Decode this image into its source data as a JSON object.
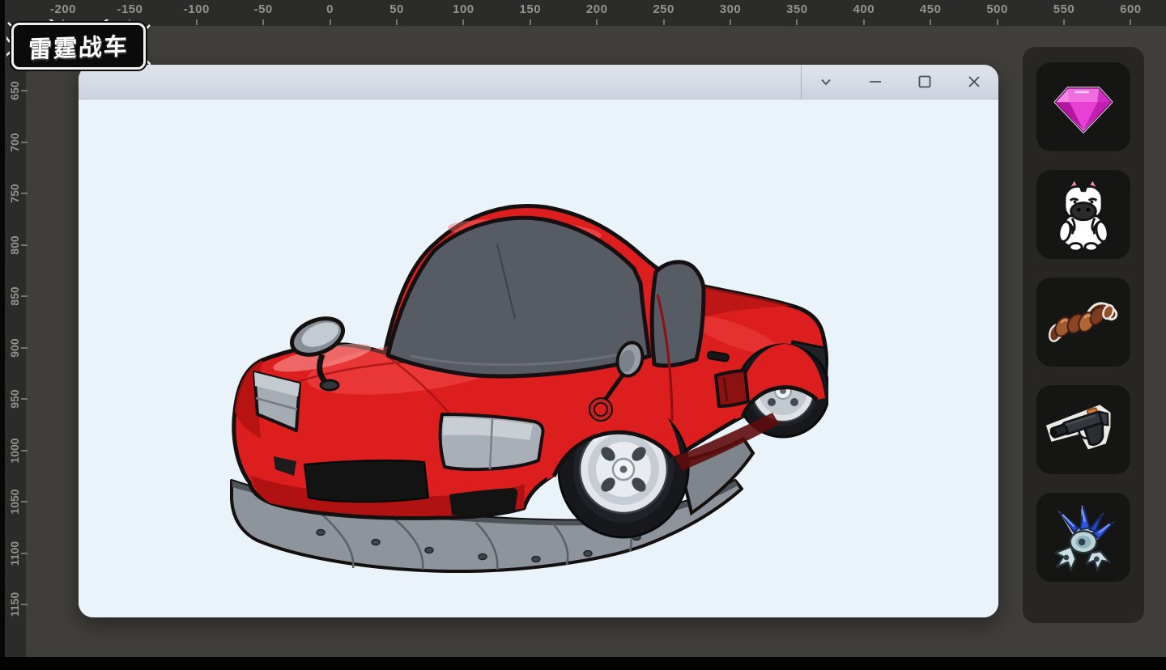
{
  "app": {
    "logo_text": "雷霆战车",
    "canvas_subject": "red cartoon sports car, front three-quarter view"
  },
  "rulers": {
    "horizontal": {
      "labels": [
        "-200",
        "-150",
        "-100",
        "-50",
        "0",
        "50",
        "100",
        "150",
        "200",
        "250",
        "300",
        "350",
        "400",
        "450",
        "500",
        "550",
        "600"
      ]
    },
    "vertical": {
      "labels": [
        "650",
        "700",
        "750",
        "800",
        "850",
        "900",
        "950",
        "1000",
        "1050",
        "1100",
        "1150"
      ]
    }
  },
  "window": {
    "controls": [
      {
        "name": "menu-chevron"
      },
      {
        "name": "minimize"
      },
      {
        "name": "maximize"
      },
      {
        "name": "close"
      }
    ]
  },
  "sidebar": {
    "items": [
      {
        "name": "pink gem"
      },
      {
        "name": "zebra figure"
      },
      {
        "name": "rusty metal part"
      },
      {
        "name": "black pistol"
      },
      {
        "name": "blue crystal drone"
      }
    ]
  },
  "colors": {
    "background": "#3f3e3a",
    "ruler_strip": "#2b2b29",
    "canvas": "#eaf3fa",
    "titlebar": "#d5dbe4",
    "sidebar_panel": "#272623",
    "sidebar_slot": "#151513",
    "car_red": "#dc1e1e",
    "gem_pink": "#e23ecf",
    "drone_blue": "#2447c9"
  }
}
